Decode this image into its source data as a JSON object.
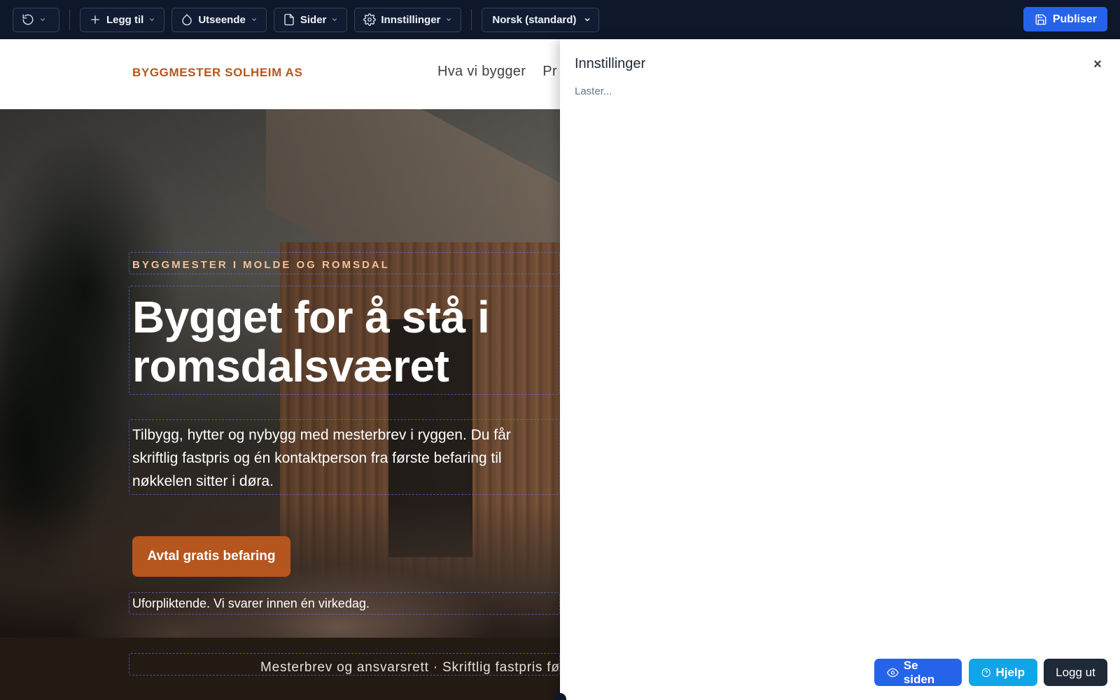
{
  "toolbar": {
    "undo_label": "",
    "add_label": "Legg til",
    "appearance_label": "Utseende",
    "pages_label": "Sider",
    "settings_label": "Innstillinger",
    "language_value": "Norsk (standard)",
    "publish_label": "Publiser"
  },
  "site": {
    "brand": "BYGGMESTER SOLHEIM AS",
    "nav": [
      "Hva vi bygger",
      "Pr"
    ],
    "hero": {
      "eyebrow": "BYGGMESTER I MOLDE OG ROMSDAL",
      "title": "Bygget for å stå i romsdalsværet",
      "text": "Tilbygg, hytter og nybygg med mesterbrev i ryggen. Du får skriftlig fastpris og én kontaktperson fra første befaring til nøkkelen sitter i døra.",
      "cta": "Avtal gratis befaring",
      "note": "Uforpliktende. Vi svarer innen én virkedag."
    },
    "trust_bar": "Mesterbrev og ansvarsrett  ·  Skriftlig fastpris fø"
  },
  "panel": {
    "title": "Innstillinger",
    "close_label": "×",
    "loading": "Laster..."
  },
  "floating": {
    "view_label": "Se siden",
    "help_label": "Hjelp",
    "logout_label": "Logg ut"
  },
  "colors": {
    "topbar": "#0f172a",
    "primary": "#2563eb",
    "help": "#0ea5e9",
    "brand_accent": "#b5561f"
  }
}
